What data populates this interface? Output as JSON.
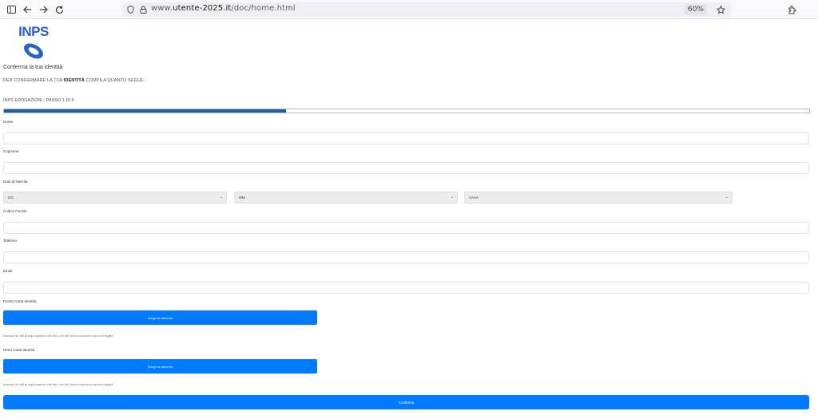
{
  "browser": {
    "url_prefix": "www.",
    "url_host": "utente-2025.it",
    "url_path": "/doc/home.html",
    "zoom": "60%"
  },
  "page": {
    "logo_text": "INPS",
    "title": "Conferma la tua identità",
    "subtitle_pre": "PER CONFERMARE LA TUA ",
    "subtitle_bold": "IDENTITÀ",
    "subtitle_post": " COMPILA QUANTO SEGUE.",
    "step_text": "INPS EROGAZIONI - PASSO 1 DI 6",
    "progress_fraction": 0.35
  },
  "form": {
    "nome_label": "Nome",
    "cognome_label": "Cognome",
    "dob_label": "Data di Nascita",
    "day_selected": "GG",
    "month_selected": "MM",
    "year_selected": "AAAA",
    "cf_label": "Codice Fiscale",
    "phone_label": "Telefono",
    "email_label": "Email",
    "front_label": "Fronte Carta Identità",
    "front_button": "Scegli un altro file",
    "front_hint": "Assicurati che tutti gli angoli appaiano nella foto e che tutti i dati sul documento siano ben leggibili",
    "back_label": "Retro Carta Identità",
    "back_button": "Scegli un altro file",
    "back_hint": "Assicurati che tutti gli angoli appaiano nella foto e che tutti i dati sul documento siano ben leggibili",
    "submit": "Conferma"
  }
}
